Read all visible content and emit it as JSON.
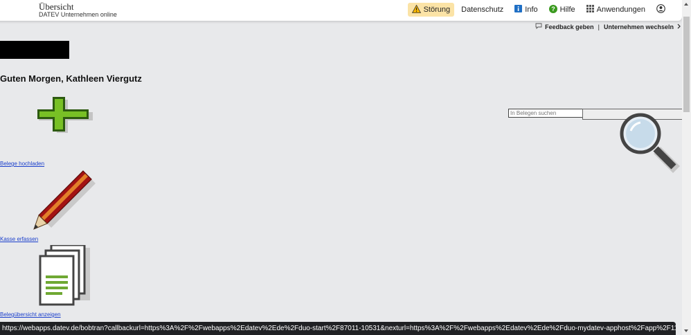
{
  "header": {
    "title": "Übersicht",
    "subtitle": "DATEV Unternehmen online",
    "nav": {
      "stoerung": "Störung",
      "datenschutz": "Datenschutz",
      "info": "Info",
      "hilfe": "Hilfe",
      "anwendungen": "Anwendungen"
    }
  },
  "feedback": {
    "feedback_label": "Feedback geben",
    "separator": "|",
    "switch_label": "Unternehmen wechseln"
  },
  "greeting": "Guten Morgen, Kathleen Viergutz",
  "actions": {
    "upload": "Belege hochladen",
    "cash": "Kasse erfassen",
    "overview": "Belegübersicht anzeigen"
  },
  "search": {
    "placeholder": "In Belegen suchen"
  },
  "status_url": "https://webapps.datev.de/bobtran?callbackurl=https%3A%2F%2Fwebapps%2Edatev%2Ede%2Fduo-start%2F87011-10531&nexturl=https%3A%2F%2Fwebapps%2Edatev%2Ede%2Fduo-mydatev-apphost%2Fapp%2F1114%3Fberaterl..."
}
